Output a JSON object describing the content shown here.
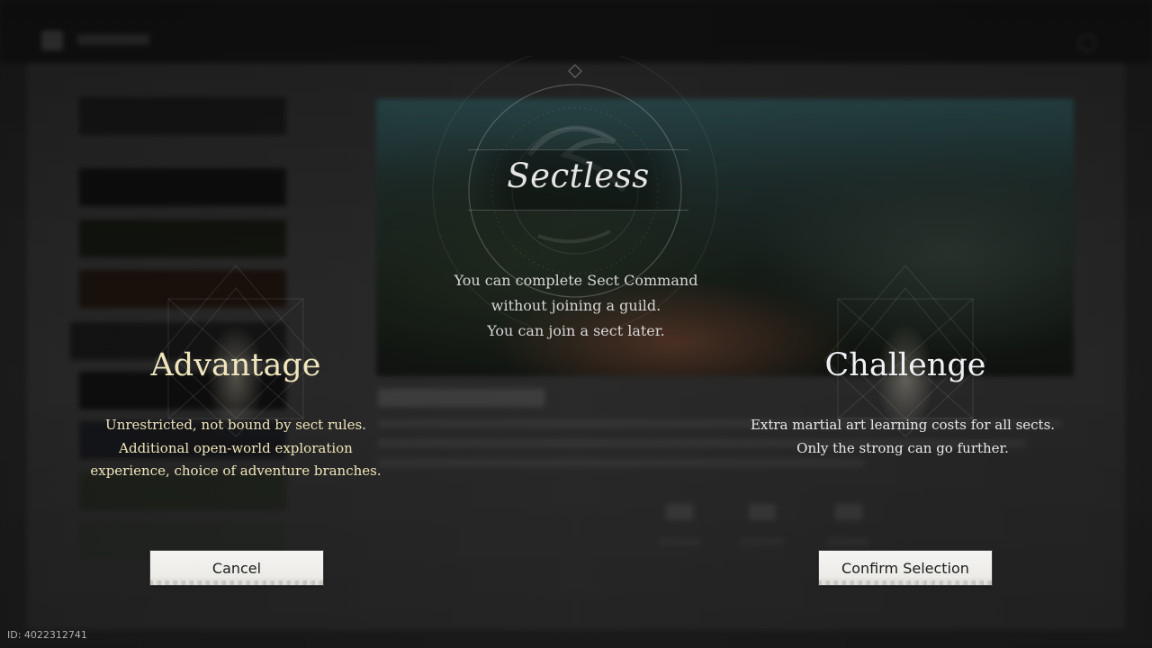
{
  "modal": {
    "title": "Sectless",
    "description": [
      "You can complete Sect Command",
      "without joining a guild.",
      "You can join a sect later."
    ]
  },
  "advantage": {
    "title": "Advantage",
    "lines": [
      "Unrestricted, not bound by sect rules.",
      "Additional open-world exploration",
      "experience, choice of adventure branches."
    ]
  },
  "challenge": {
    "title": "Challenge",
    "lines": [
      "Extra martial art learning costs for all sects.",
      "Only the strong can go further."
    ]
  },
  "buttons": {
    "cancel": "Cancel",
    "confirm": "Confirm Selection"
  },
  "footer": {
    "id_label": "ID: 4022312741"
  },
  "colors": {
    "advantage_text": "#efe5b9",
    "challenge_text": "#e9e9e9",
    "button_bg": "#f0efeb"
  }
}
